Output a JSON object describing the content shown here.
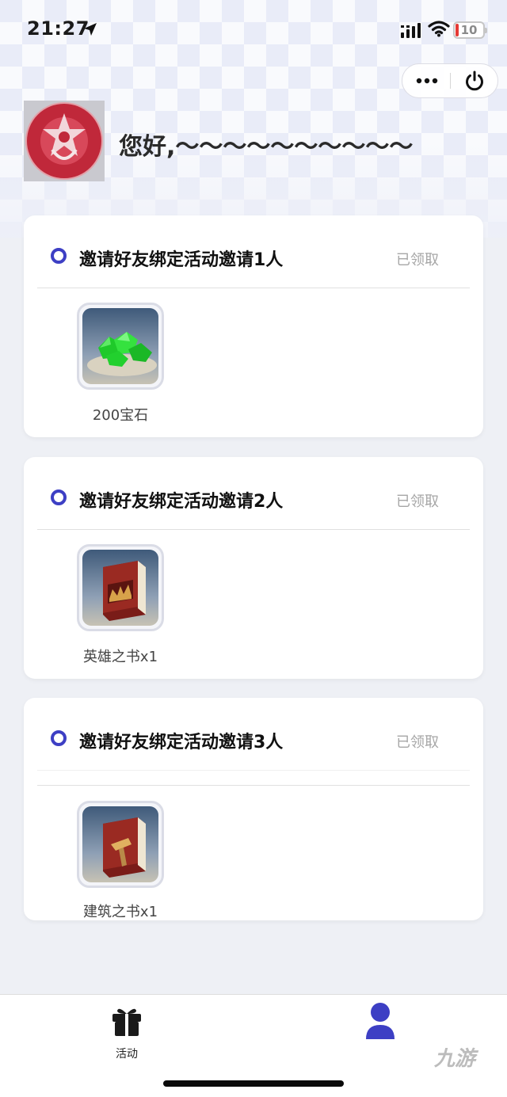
{
  "status_bar": {
    "time": "21:27",
    "battery": "10",
    "battery_color": "#e53935"
  },
  "header": {
    "greeting": "您好,～～～～～～～～～～"
  },
  "tasks": [
    {
      "title": "邀请好友绑定活动邀请1人",
      "status": "已领取",
      "reward": {
        "label": "200宝石",
        "icon": "green-gems-icon"
      }
    },
    {
      "title": "邀请好友绑定活动邀请2人",
      "status": "已领取",
      "reward": {
        "label": "英雄之书x1",
        "icon": "hero-book-icon"
      }
    },
    {
      "title": "邀请好友绑定活动邀请3人",
      "status": "已领取",
      "reward": {
        "label": "建筑之书x1",
        "icon": "building-book-icon"
      }
    }
  ],
  "tabbar": {
    "activity_label": "活动",
    "accent_color": "#3d3fc4"
  },
  "watermark": "九游"
}
